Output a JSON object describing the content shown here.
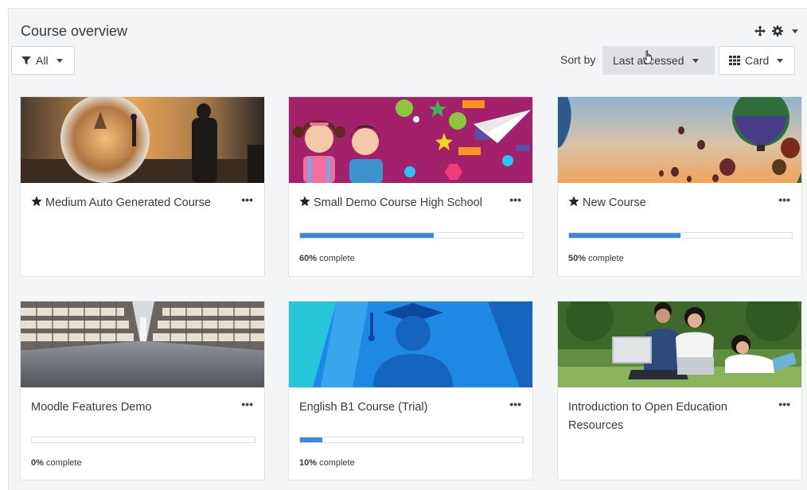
{
  "block": {
    "title": "Course overview",
    "controls": {
      "move_icon": "move-icon",
      "gear_icon": "gear-icon"
    }
  },
  "toolbar": {
    "filter_label": "All",
    "filter_icon": "filter-icon",
    "sort_by_label": "Sort by",
    "sort_value": "Last accessed",
    "view_value": "Card",
    "view_icon": "grid-icon"
  },
  "colors": {
    "progress": "#3b8ad9",
    "sort_bg": "#dfe1e4",
    "panel_bg": "#f4f5f6"
  },
  "courses": [
    {
      "name": "Medium Auto Generated Course",
      "starred": true,
      "has_progress": false,
      "progress_pct": null,
      "progress_value": "",
      "progress_suffix": ""
    },
    {
      "name": "Small Demo Course High School",
      "starred": true,
      "has_progress": true,
      "progress_pct": 60,
      "progress_value": "60%",
      "progress_suffix": " complete"
    },
    {
      "name": "New Course",
      "starred": true,
      "has_progress": true,
      "progress_pct": 50,
      "progress_value": "50%",
      "progress_suffix": " complete"
    },
    {
      "name": "Moodle Features Demo",
      "starred": false,
      "has_progress": true,
      "progress_pct": 0,
      "progress_value": "0%",
      "progress_suffix": " complete"
    },
    {
      "name": "English B1 Course (Trial)",
      "starred": false,
      "has_progress": true,
      "progress_pct": 10,
      "progress_value": "10%",
      "progress_suffix": " complete"
    },
    {
      "name": "Introduction to Open Education Resources",
      "starred": false,
      "has_progress": false,
      "progress_pct": null,
      "progress_value": "",
      "progress_suffix": ""
    }
  ],
  "card_menu_glyph": "•••"
}
